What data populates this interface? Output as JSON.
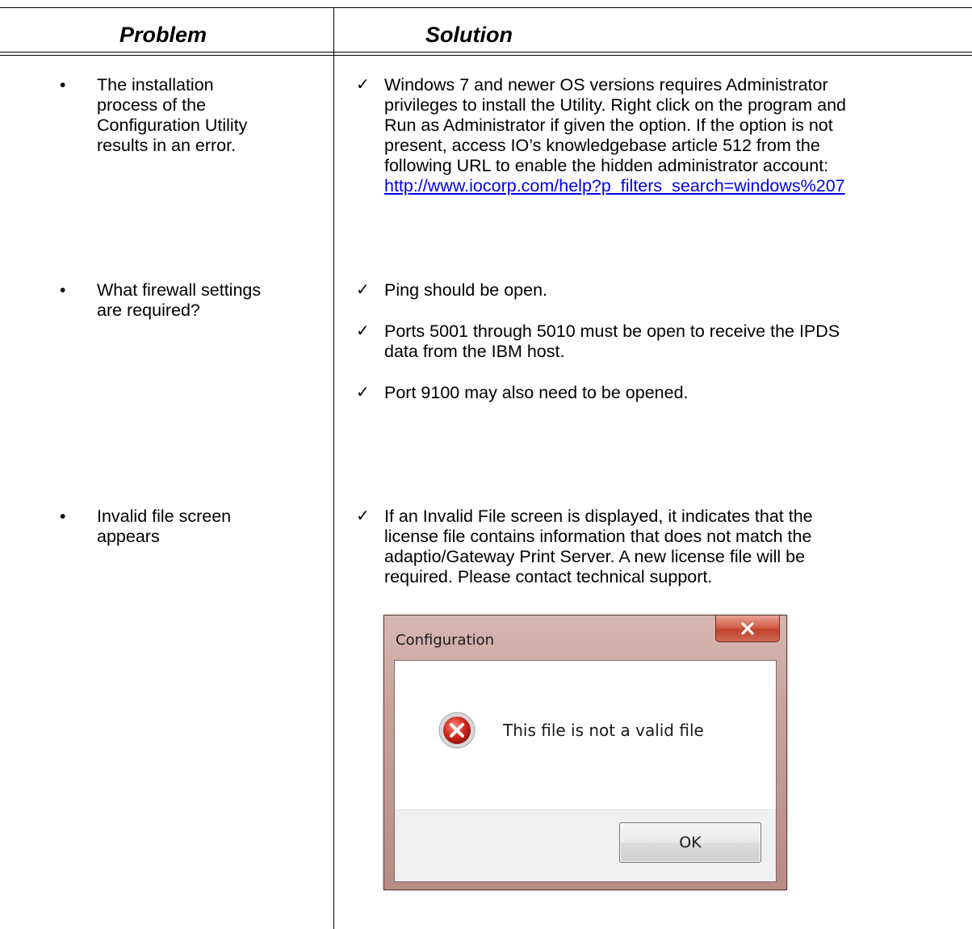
{
  "table": {
    "headers": {
      "problem": "Problem",
      "solution": "Solution"
    },
    "rows": [
      {
        "problem": [
          "The installation",
          "process of the",
          "Configuration Utility",
          "results in an error."
        ],
        "solutions": [
          {
            "lines": [
              "Windows 7 and newer OS versions requires Administrator",
              "privileges to install the Utility. Right click on the program and",
              "Run as Administrator if given the option. If the option is not",
              "present, access IO’s knowledgebase article 512 from the",
              "following URL to enable the hidden administrator account:"
            ],
            "link": "http://www.iocorp.com/help?p_filters_search=windows%207"
          }
        ]
      },
      {
        "problem": [
          "What firewall settings",
          "are required?"
        ],
        "solutions": [
          {
            "lines": [
              "Ping should be open."
            ]
          },
          {
            "lines": [
              "Ports 5001 through 5010 must be open to receive the IPDS",
              "data from the IBM host."
            ]
          },
          {
            "lines": [
              "Port 9100 may also need to be opened."
            ]
          }
        ]
      },
      {
        "problem": [
          "Invalid file screen",
          "appears"
        ],
        "solutions": [
          {
            "lines": [
              "If an Invalid File screen is displayed, it indicates that the",
              "license file contains information that does not match the",
              "adaptio/Gateway Print Server.  A new license file will be",
              "required.  Please contact technical support."
            ]
          }
        ]
      }
    ],
    "bullet_glyph": "•",
    "check_glyph": "✓"
  },
  "dialog": {
    "title": "Configuration",
    "close_label": "X",
    "message": "This file is not a valid file",
    "ok_label": "OK",
    "icon": "error-icon"
  },
  "colors": {
    "link": "#0000ee",
    "dialog_frame": "#b98c86",
    "close_button": "#c0422d"
  }
}
